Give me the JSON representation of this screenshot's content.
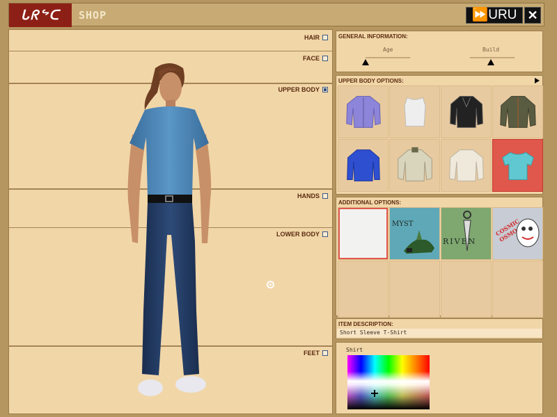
{
  "window": {
    "logo_text": "ᒐᖇᖦᑕ",
    "title": "SHOP",
    "uru_label": "⏩URU",
    "close_label": "✕"
  },
  "categories": [
    {
      "label": "HAIR",
      "checked": false
    },
    {
      "label": "FACE",
      "checked": false
    },
    {
      "label": "UPPER BODY",
      "checked": true
    },
    {
      "label": "HANDS",
      "checked": false
    },
    {
      "label": "LOWER BODY",
      "checked": false
    },
    {
      "label": "FEET",
      "checked": false
    }
  ],
  "general": {
    "header": "GENERAL INFORMATION:",
    "age_label": "Age",
    "build_label": "Build",
    "age_value": 0,
    "build_value": 0.5
  },
  "upper_body": {
    "header": "UPPER BODY OPTIONS:",
    "items": [
      {
        "name": "lavender-jacket",
        "color": "#8c85d9",
        "selected": false
      },
      {
        "name": "white-tank-top",
        "color": "#eeeeee",
        "selected": false
      },
      {
        "name": "black-leather-jacket",
        "color": "#222222",
        "selected": false
      },
      {
        "name": "olive-jacket",
        "color": "#5a5c42",
        "selected": false
      },
      {
        "name": "blue-long-sleeve",
        "color": "#2e4fd0",
        "selected": false
      },
      {
        "name": "grey-sweater",
        "color": "#d9d4bc",
        "selected": false
      },
      {
        "name": "cream-long-sleeve",
        "color": "#efe9db",
        "selected": false
      },
      {
        "name": "short-sleeve-t-shirt",
        "color": "#5fc8d0",
        "selected": true
      }
    ]
  },
  "additional": {
    "header": "ADDITIONAL OPTIONS:",
    "decals": [
      {
        "name": "plain",
        "label": "",
        "selected": true
      },
      {
        "name": "myst",
        "label": "MYST",
        "selected": false
      },
      {
        "name": "riven",
        "label": "RIVEN",
        "selected": false
      },
      {
        "name": "cosmic-osmo",
        "label": "COSMIC OSMO",
        "selected": false
      }
    ]
  },
  "description": {
    "header": "ITEM DESCRIPTION:",
    "text": "Short Sleeve T-Shirt"
  },
  "color": {
    "label": "Shirt"
  },
  "colors": {
    "shirt": "#4a86b8",
    "jeans": "#233d66",
    "skin": "#c89068",
    "hair": "#6e3e22",
    "accent_red": "#8d2016"
  }
}
